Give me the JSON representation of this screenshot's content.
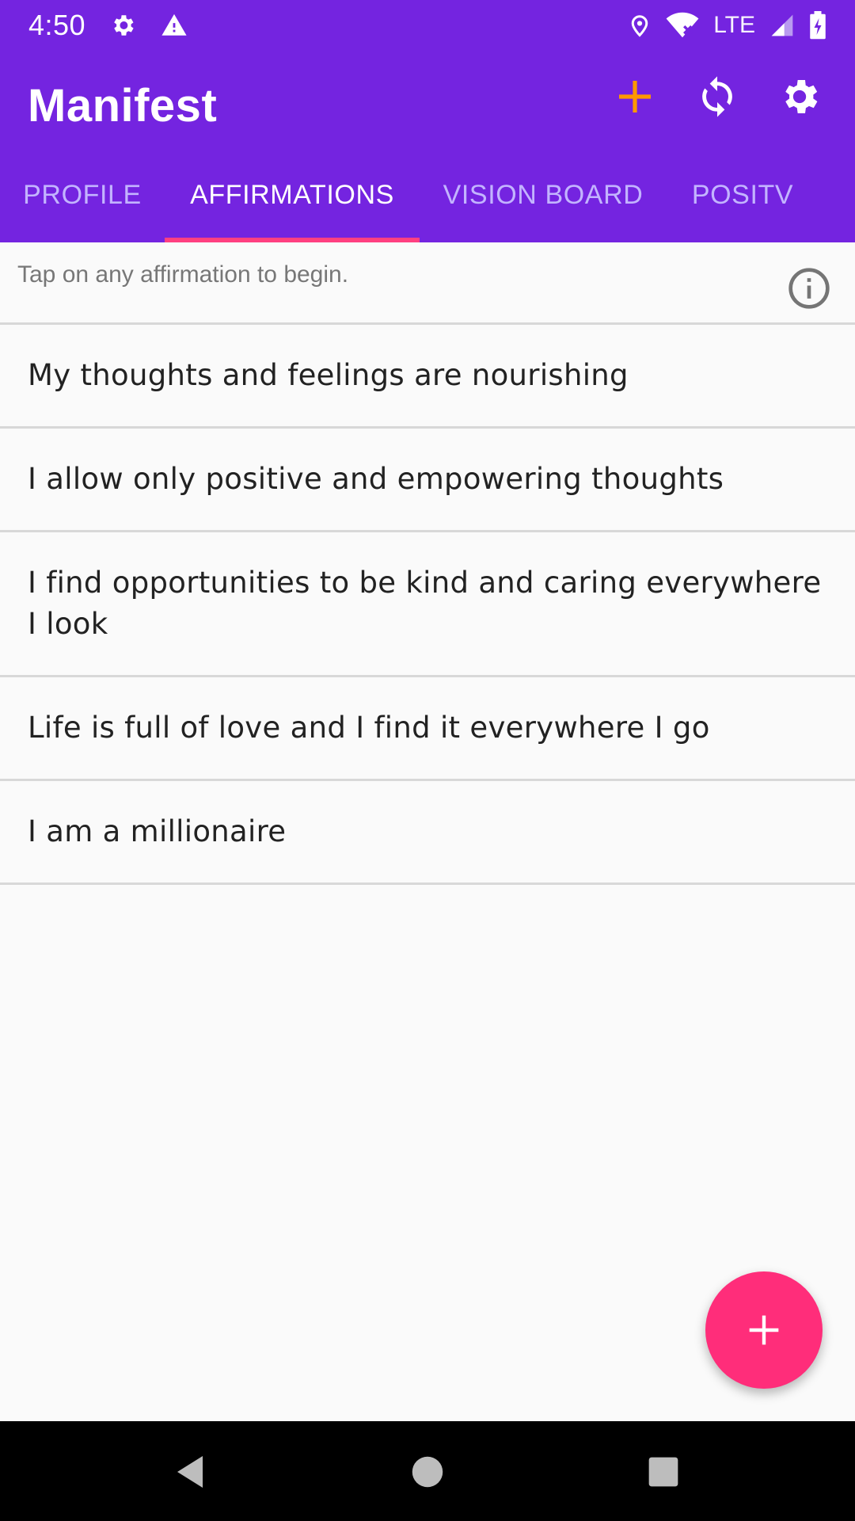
{
  "status_bar": {
    "time": "4:50",
    "network": "LTE",
    "icons": [
      "settings-icon",
      "warning-icon",
      "location-icon",
      "wifi-icon",
      "signal-icon",
      "battery-charging-icon"
    ]
  },
  "app_bar": {
    "title": "Manifest",
    "actions": [
      "add-icon",
      "sync-icon",
      "gear-icon"
    ],
    "accent_color": "#ff9800",
    "background_color": "#7424e0"
  },
  "tabs": [
    {
      "label": "PROFILE",
      "active": false
    },
    {
      "label": "AFFIRMATIONS",
      "active": true
    },
    {
      "label": "VISION BOARD",
      "active": false
    },
    {
      "label": "POSITV",
      "active": false
    }
  ],
  "hint": {
    "text": "Tap on any affirmation to begin.",
    "icon": "info-icon"
  },
  "affirmations": [
    "My thoughts and feelings are nourishing",
    "I allow only positive and empowering thoughts",
    "I find opportunities to be kind and caring everywhere I look",
    "Life is full of love and I find it everywhere I go",
    "I am a millionaire"
  ],
  "fab": {
    "icon": "add-icon",
    "color": "#ff2d7a"
  },
  "nav_bar": {
    "buttons": [
      "back-icon",
      "home-icon",
      "recents-icon"
    ]
  }
}
